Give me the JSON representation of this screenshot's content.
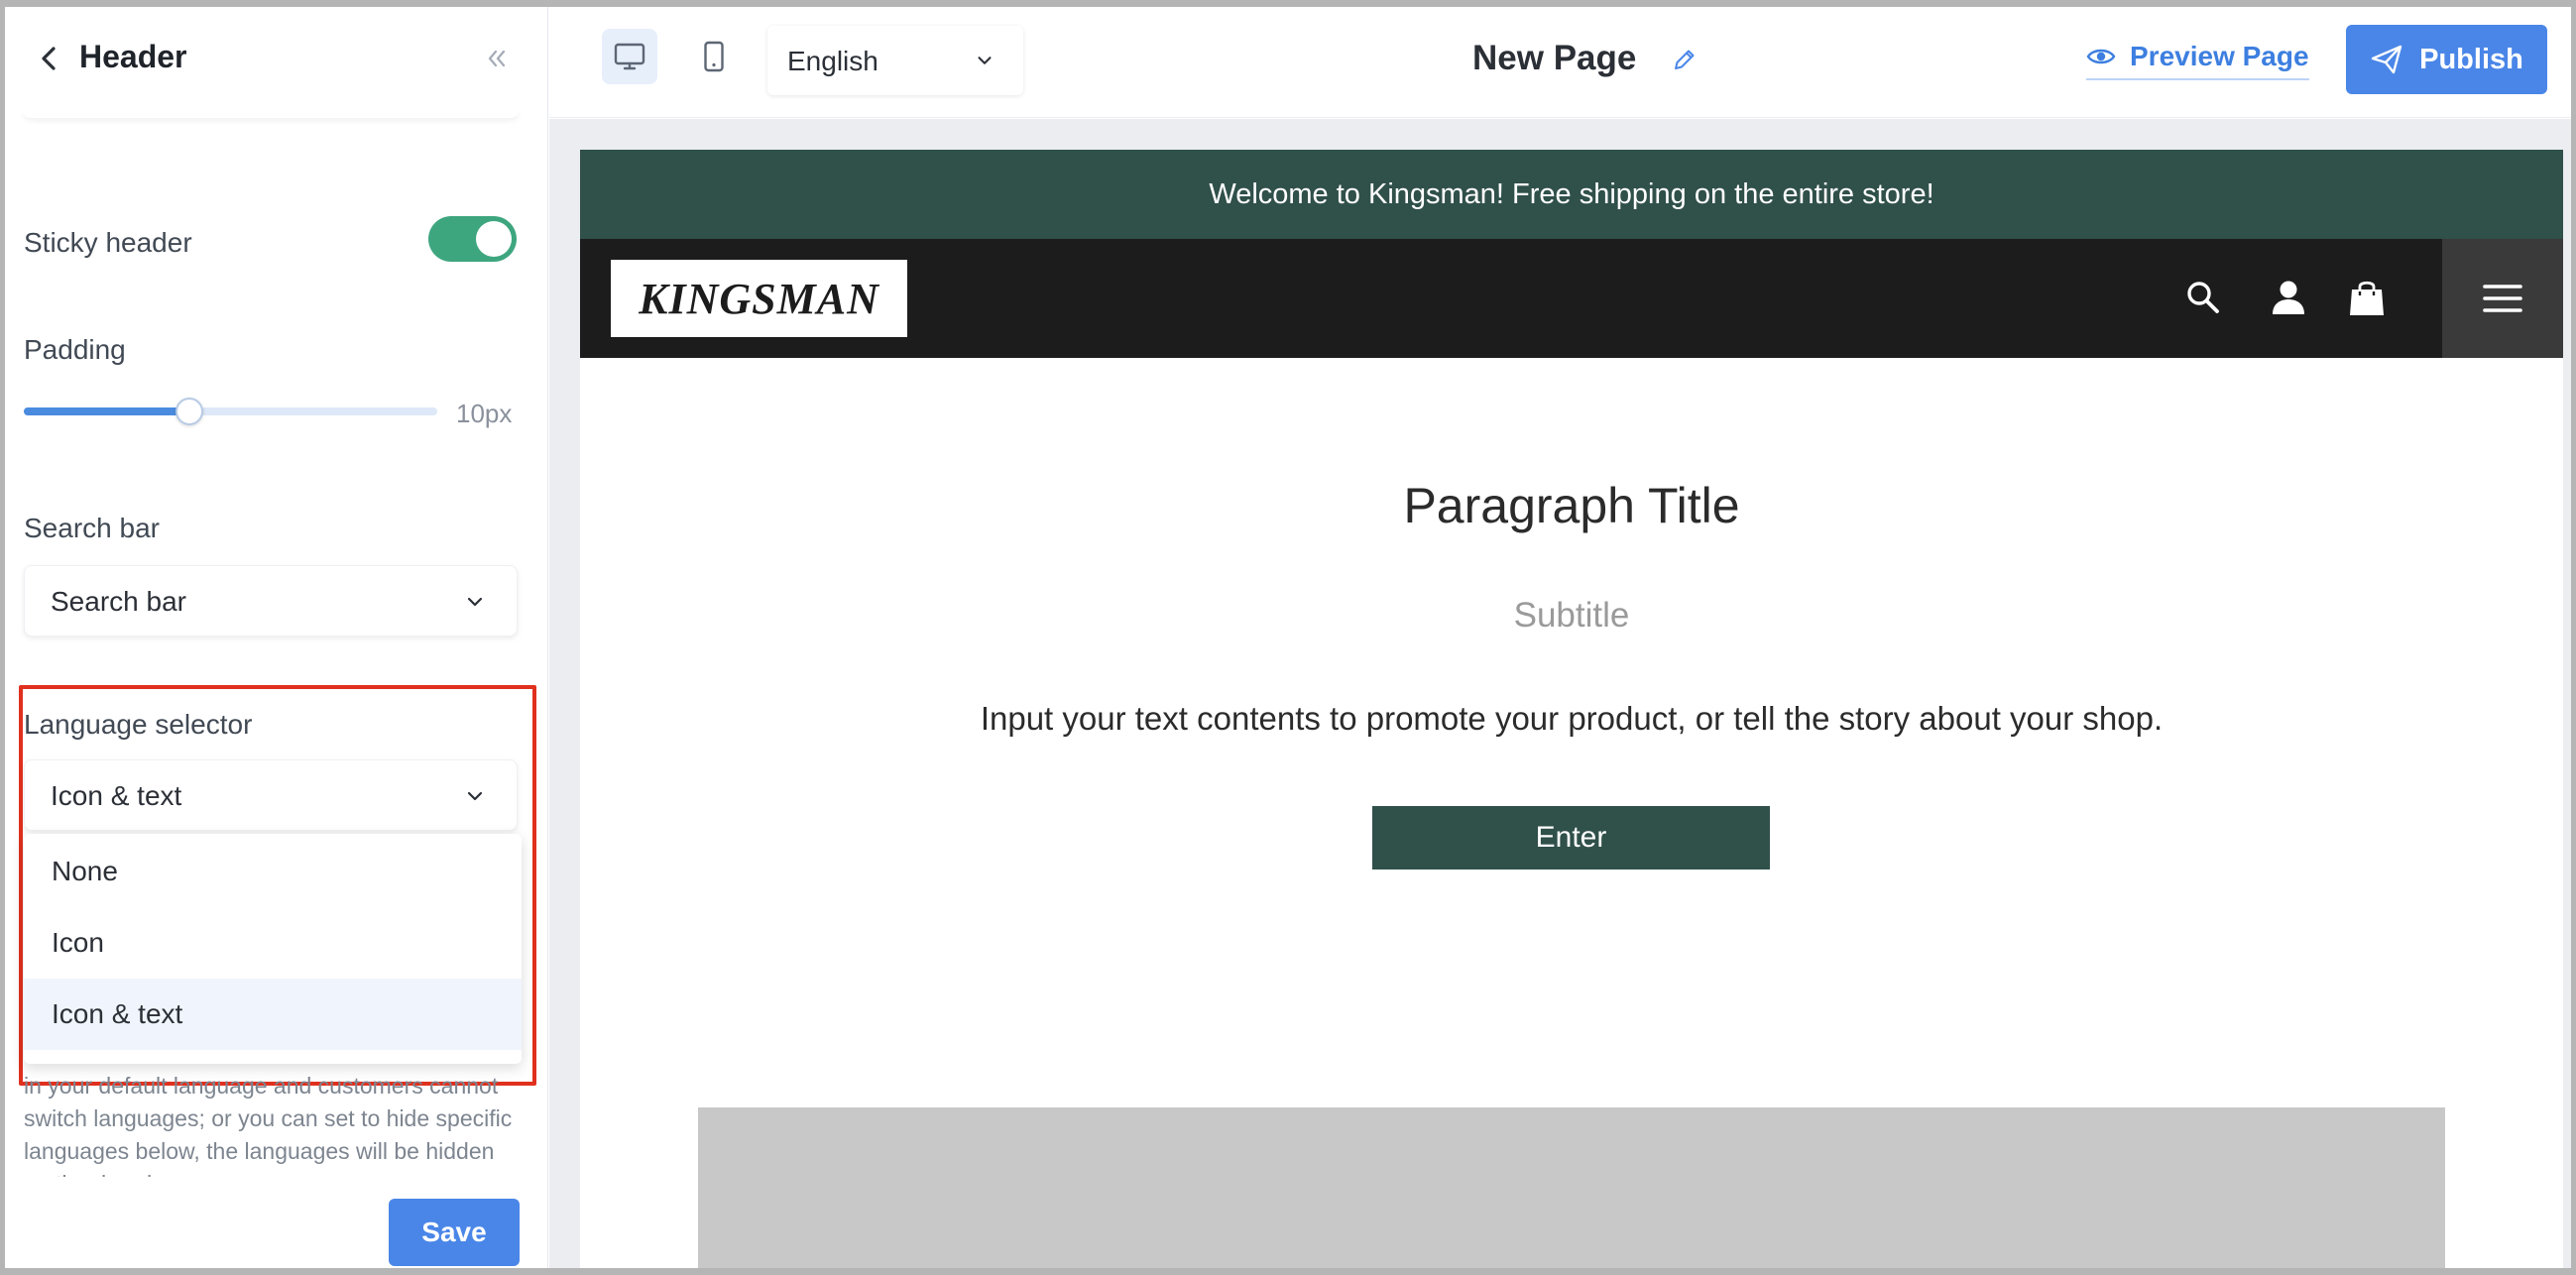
{
  "sidebar": {
    "title": "Header",
    "sticky_header": {
      "label": "Sticky header",
      "enabled": true
    },
    "padding": {
      "label": "Padding",
      "value_label": "10px",
      "fraction": 0.4
    },
    "search_bar": {
      "label": "Search bar",
      "selected": "Search bar"
    },
    "language_selector": {
      "label": "Language selector",
      "selected": "Icon & text",
      "options": [
        "None",
        "Icon",
        "Icon & text"
      ]
    },
    "help_text": "in your default language and customers cannot switch languages; or you can set to hide specific languages below, the languages will be hidden on the dropdown",
    "save_label": "Save"
  },
  "topbar": {
    "language": "English",
    "page_title": "New Page",
    "preview_label": "Preview Page",
    "publish_label": "Publish",
    "active_device": "desktop"
  },
  "preview": {
    "announcement": "Welcome to Kingsman! Free shipping on the entire store!",
    "logo_text": "KINGSMAN",
    "paragraph_title": "Paragraph Title",
    "subtitle": "Subtitle",
    "body": "Input your text contents to promote your product, or tell the story about your shop.",
    "button_label": "Enter"
  },
  "colors": {
    "accent": "#4a86e8",
    "toggle_on": "#3ea67f",
    "announcement_bg": "#30504a",
    "header_bg": "#1c1c1c",
    "highlight": "#e0301e"
  }
}
